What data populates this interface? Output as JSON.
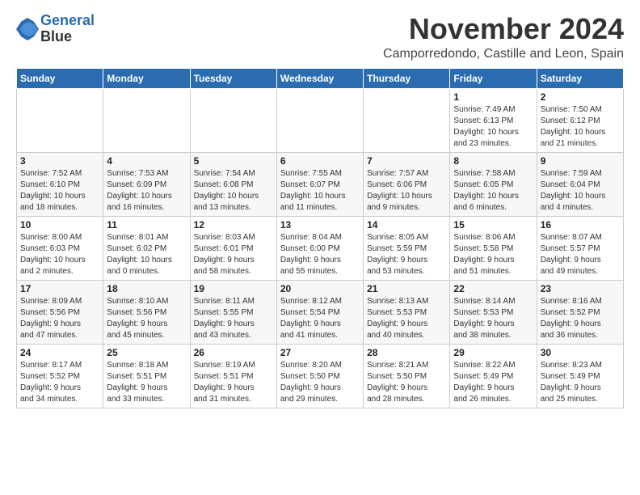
{
  "logo": {
    "line1": "General",
    "line2": "Blue"
  },
  "title": "November 2024",
  "subtitle": "Camporredondo, Castille and Leon, Spain",
  "headers": [
    "Sunday",
    "Monday",
    "Tuesday",
    "Wednesday",
    "Thursday",
    "Friday",
    "Saturday"
  ],
  "weeks": [
    [
      {
        "day": "",
        "info": ""
      },
      {
        "day": "",
        "info": ""
      },
      {
        "day": "",
        "info": ""
      },
      {
        "day": "",
        "info": ""
      },
      {
        "day": "",
        "info": ""
      },
      {
        "day": "1",
        "info": "Sunrise: 7:49 AM\nSunset: 6:13 PM\nDaylight: 10 hours\nand 23 minutes."
      },
      {
        "day": "2",
        "info": "Sunrise: 7:50 AM\nSunset: 6:12 PM\nDaylight: 10 hours\nand 21 minutes."
      }
    ],
    [
      {
        "day": "3",
        "info": "Sunrise: 7:52 AM\nSunset: 6:10 PM\nDaylight: 10 hours\nand 18 minutes."
      },
      {
        "day": "4",
        "info": "Sunrise: 7:53 AM\nSunset: 6:09 PM\nDaylight: 10 hours\nand 16 minutes."
      },
      {
        "day": "5",
        "info": "Sunrise: 7:54 AM\nSunset: 6:08 PM\nDaylight: 10 hours\nand 13 minutes."
      },
      {
        "day": "6",
        "info": "Sunrise: 7:55 AM\nSunset: 6:07 PM\nDaylight: 10 hours\nand 11 minutes."
      },
      {
        "day": "7",
        "info": "Sunrise: 7:57 AM\nSunset: 6:06 PM\nDaylight: 10 hours\nand 9 minutes."
      },
      {
        "day": "8",
        "info": "Sunrise: 7:58 AM\nSunset: 6:05 PM\nDaylight: 10 hours\nand 6 minutes."
      },
      {
        "day": "9",
        "info": "Sunrise: 7:59 AM\nSunset: 6:04 PM\nDaylight: 10 hours\nand 4 minutes."
      }
    ],
    [
      {
        "day": "10",
        "info": "Sunrise: 8:00 AM\nSunset: 6:03 PM\nDaylight: 10 hours\nand 2 minutes."
      },
      {
        "day": "11",
        "info": "Sunrise: 8:01 AM\nSunset: 6:02 PM\nDaylight: 10 hours\nand 0 minutes."
      },
      {
        "day": "12",
        "info": "Sunrise: 8:03 AM\nSunset: 6:01 PM\nDaylight: 9 hours\nand 58 minutes."
      },
      {
        "day": "13",
        "info": "Sunrise: 8:04 AM\nSunset: 6:00 PM\nDaylight: 9 hours\nand 55 minutes."
      },
      {
        "day": "14",
        "info": "Sunrise: 8:05 AM\nSunset: 5:59 PM\nDaylight: 9 hours\nand 53 minutes."
      },
      {
        "day": "15",
        "info": "Sunrise: 8:06 AM\nSunset: 5:58 PM\nDaylight: 9 hours\nand 51 minutes."
      },
      {
        "day": "16",
        "info": "Sunrise: 8:07 AM\nSunset: 5:57 PM\nDaylight: 9 hours\nand 49 minutes."
      }
    ],
    [
      {
        "day": "17",
        "info": "Sunrise: 8:09 AM\nSunset: 5:56 PM\nDaylight: 9 hours\nand 47 minutes."
      },
      {
        "day": "18",
        "info": "Sunrise: 8:10 AM\nSunset: 5:56 PM\nDaylight: 9 hours\nand 45 minutes."
      },
      {
        "day": "19",
        "info": "Sunrise: 8:11 AM\nSunset: 5:55 PM\nDaylight: 9 hours\nand 43 minutes."
      },
      {
        "day": "20",
        "info": "Sunrise: 8:12 AM\nSunset: 5:54 PM\nDaylight: 9 hours\nand 41 minutes."
      },
      {
        "day": "21",
        "info": "Sunrise: 8:13 AM\nSunset: 5:53 PM\nDaylight: 9 hours\nand 40 minutes."
      },
      {
        "day": "22",
        "info": "Sunrise: 8:14 AM\nSunset: 5:53 PM\nDaylight: 9 hours\nand 38 minutes."
      },
      {
        "day": "23",
        "info": "Sunrise: 8:16 AM\nSunset: 5:52 PM\nDaylight: 9 hours\nand 36 minutes."
      }
    ],
    [
      {
        "day": "24",
        "info": "Sunrise: 8:17 AM\nSunset: 5:52 PM\nDaylight: 9 hours\nand 34 minutes."
      },
      {
        "day": "25",
        "info": "Sunrise: 8:18 AM\nSunset: 5:51 PM\nDaylight: 9 hours\nand 33 minutes."
      },
      {
        "day": "26",
        "info": "Sunrise: 8:19 AM\nSunset: 5:51 PM\nDaylight: 9 hours\nand 31 minutes."
      },
      {
        "day": "27",
        "info": "Sunrise: 8:20 AM\nSunset: 5:50 PM\nDaylight: 9 hours\nand 29 minutes."
      },
      {
        "day": "28",
        "info": "Sunrise: 8:21 AM\nSunset: 5:50 PM\nDaylight: 9 hours\nand 28 minutes."
      },
      {
        "day": "29",
        "info": "Sunrise: 8:22 AM\nSunset: 5:49 PM\nDaylight: 9 hours\nand 26 minutes."
      },
      {
        "day": "30",
        "info": "Sunrise: 8:23 AM\nSunset: 5:49 PM\nDaylight: 9 hours\nand 25 minutes."
      }
    ]
  ]
}
